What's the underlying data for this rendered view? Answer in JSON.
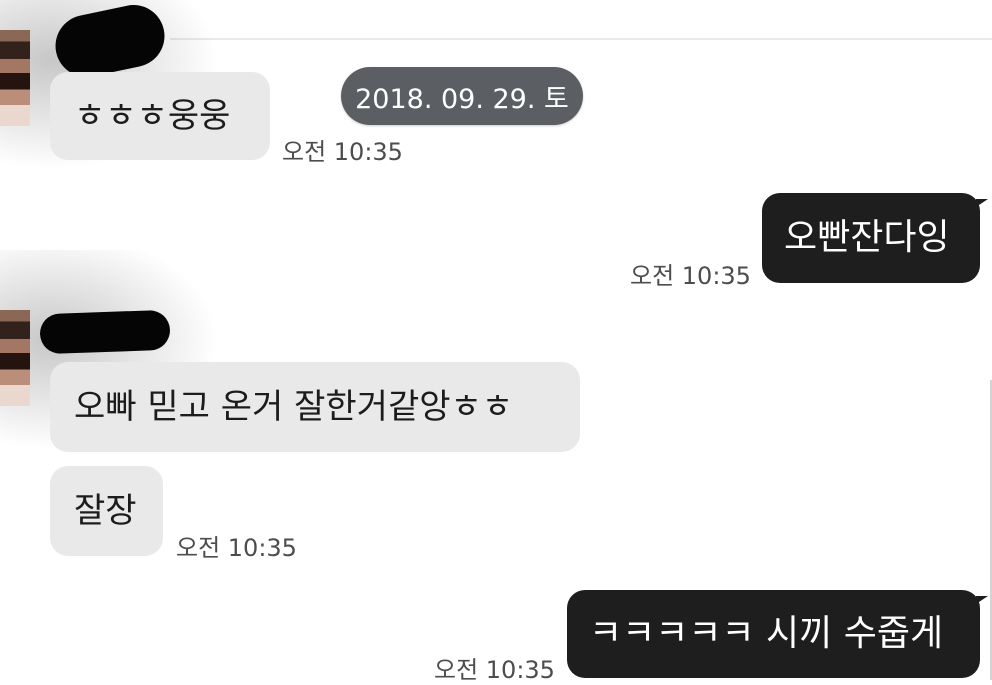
{
  "date_divider": "2018. 09. 29. 토",
  "messages": [
    {
      "side": "in",
      "text": "ㅎㅎㅎ웅웅",
      "time": "오전 10:35"
    },
    {
      "side": "out",
      "text": "오빤잔다잉",
      "time": "오전 10:35"
    },
    {
      "side": "in",
      "text": "오빠 믿고 온거 잘한거같앙ㅎㅎ"
    },
    {
      "side": "in",
      "text": "잘장",
      "time": "오전 10:35"
    },
    {
      "side": "out",
      "text": "ㅋㅋㅋㅋㅋ 시끼 수줍게",
      "time": "오전 10:35"
    }
  ]
}
